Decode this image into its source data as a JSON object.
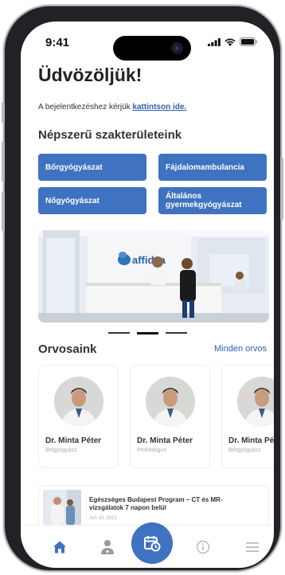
{
  "status_bar": {
    "time": "9:41"
  },
  "home": {
    "greeting": "Üdvözöljük!",
    "login_prompt": "A bejelentkezéshez kérjük",
    "login_link": "kattintson ide."
  },
  "specialties": {
    "title": "Népszerű szakterületeink",
    "items": [
      {
        "label": "Bőrgyógyászat"
      },
      {
        "label": "Fájdalomambulancia"
      },
      {
        "label": "Nőgyógyászat"
      },
      {
        "label": "Általános gyermekgyógyászat"
      }
    ]
  },
  "banner": {
    "logo_text": "affidea",
    "page_count": 3,
    "active_page": 2
  },
  "doctors": {
    "title": "Orvosaink",
    "all_link": "Minden orvos",
    "items": [
      {
        "name": "Dr. Minta Péter",
        "specialty": "Belgyógyász"
      },
      {
        "name": "Dr. Minta Péter",
        "specialty": "Proktológus"
      },
      {
        "name": "Dr. Minta Péter",
        "specialty": "Bőrgyógyász"
      }
    ]
  },
  "news": {
    "title": "Egészséges Budapest Program – CT és MR-vizsgálatok 7 napon belül",
    "date": "Jun 10, 2021"
  },
  "tabbar": {
    "tabs": [
      "home-icon",
      "doctor-icon",
      "calendar-clock-icon",
      "info-icon",
      "menu-icon"
    ],
    "accent_color": "#3f72c0"
  }
}
